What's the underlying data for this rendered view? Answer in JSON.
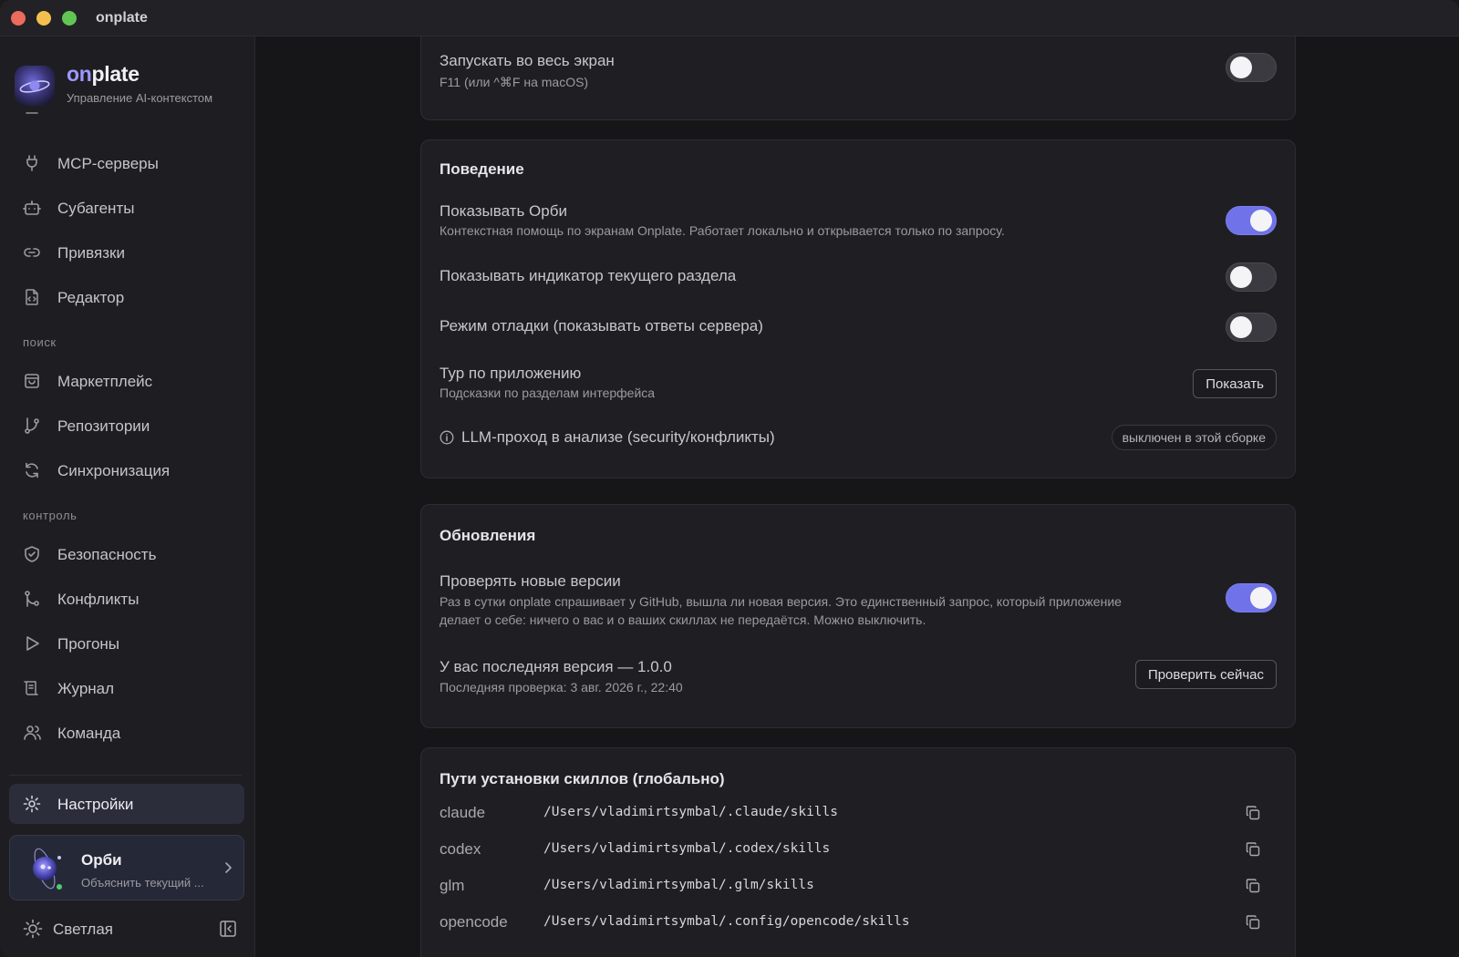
{
  "window": {
    "title": "onplate"
  },
  "brand": {
    "name_accent": "on",
    "name_rest": "plate",
    "subtitle": "Управление AI-контекстом"
  },
  "sidebar": {
    "items_top": [
      {
        "key": "mcp",
        "label": "MCP-серверы",
        "icon": "plug-icon"
      },
      {
        "key": "subagents",
        "label": "Субагенты",
        "icon": "robot-icon"
      },
      {
        "key": "bindings",
        "label": "Привязки",
        "icon": "link-icon"
      },
      {
        "key": "editor",
        "label": "Редактор",
        "icon": "code-file-icon"
      }
    ],
    "section_search": "поиск",
    "items_search": [
      {
        "key": "marketplace",
        "label": "Маркетплейс",
        "icon": "store-icon"
      },
      {
        "key": "repos",
        "label": "Репозитории",
        "icon": "git-branch-icon"
      },
      {
        "key": "sync",
        "label": "Синхронизация",
        "icon": "refresh-icon"
      }
    ],
    "section_control": "контроль",
    "items_control": [
      {
        "key": "security",
        "label": "Безопасность",
        "icon": "shield-icon"
      },
      {
        "key": "conflicts",
        "label": "Конфликты",
        "icon": "git-merge-icon"
      },
      {
        "key": "runs",
        "label": "Прогоны",
        "icon": "play-icon"
      },
      {
        "key": "journal",
        "label": "Журнал",
        "icon": "scroll-icon"
      },
      {
        "key": "team",
        "label": "Команда",
        "icon": "users-icon"
      }
    ],
    "settings_label": "Настройки",
    "orbi": {
      "name": "Орби",
      "subtitle": "Объяснить текущий ..."
    },
    "theme_label": "Светлая"
  },
  "main": {
    "fullscreen": {
      "title": "Запускать во весь экран",
      "desc": "F11 (или ^⌘F на macOS)",
      "enabled": false
    },
    "behavior": {
      "title": "Поведение",
      "show_orbi": {
        "title": "Показывать Орби",
        "desc": "Контекстная помощь по экранам Onplate. Работает локально и открывается только по запросу.",
        "enabled": true
      },
      "section_indicator": {
        "title": "Показывать индикатор текущего раздела",
        "enabled": false
      },
      "debug_mode": {
        "title": "Режим отладки (показывать ответы сервера)",
        "enabled": false
      },
      "tour": {
        "title": "Тур по приложению",
        "desc": "Подсказки по разделам интерфейса",
        "button": "Показать"
      },
      "llm": {
        "title": "LLM-проход в анализе (security/конфликты)",
        "status": "выключен в этой сборке"
      }
    },
    "updates": {
      "title": "Обновления",
      "check": {
        "title": "Проверять новые версии",
        "desc": "Раз в сутки onplate спрашивает у GitHub, вышла ли новая версия. Это единственный запрос, который приложение делает о себе: ничего о вас и о ваших скиллах не передаётся. Можно выключить.",
        "enabled": true
      },
      "version": {
        "title": "У вас последняя версия — 1.0.0",
        "desc": "Последняя проверка: 3 авг. 2026 г., 22:40",
        "button": "Проверить сейчас"
      }
    },
    "paths": {
      "title": "Пути установки скиллов (глобально)",
      "rows": [
        {
          "agent": "claude",
          "path": "/Users/vladimirtsymbal/.claude/skills"
        },
        {
          "agent": "codex",
          "path": "/Users/vladimirtsymbal/.codex/skills"
        },
        {
          "agent": "glm",
          "path": "/Users/vladimirtsymbal/.glm/skills"
        },
        {
          "agent": "opencode",
          "path": "/Users/vladimirtsymbal/.config/opencode/skills"
        }
      ]
    }
  },
  "colors": {
    "accent": "#6f72e8",
    "background": "#161619",
    "card": "#1f1f23",
    "sidebar": "#1e1e22"
  }
}
